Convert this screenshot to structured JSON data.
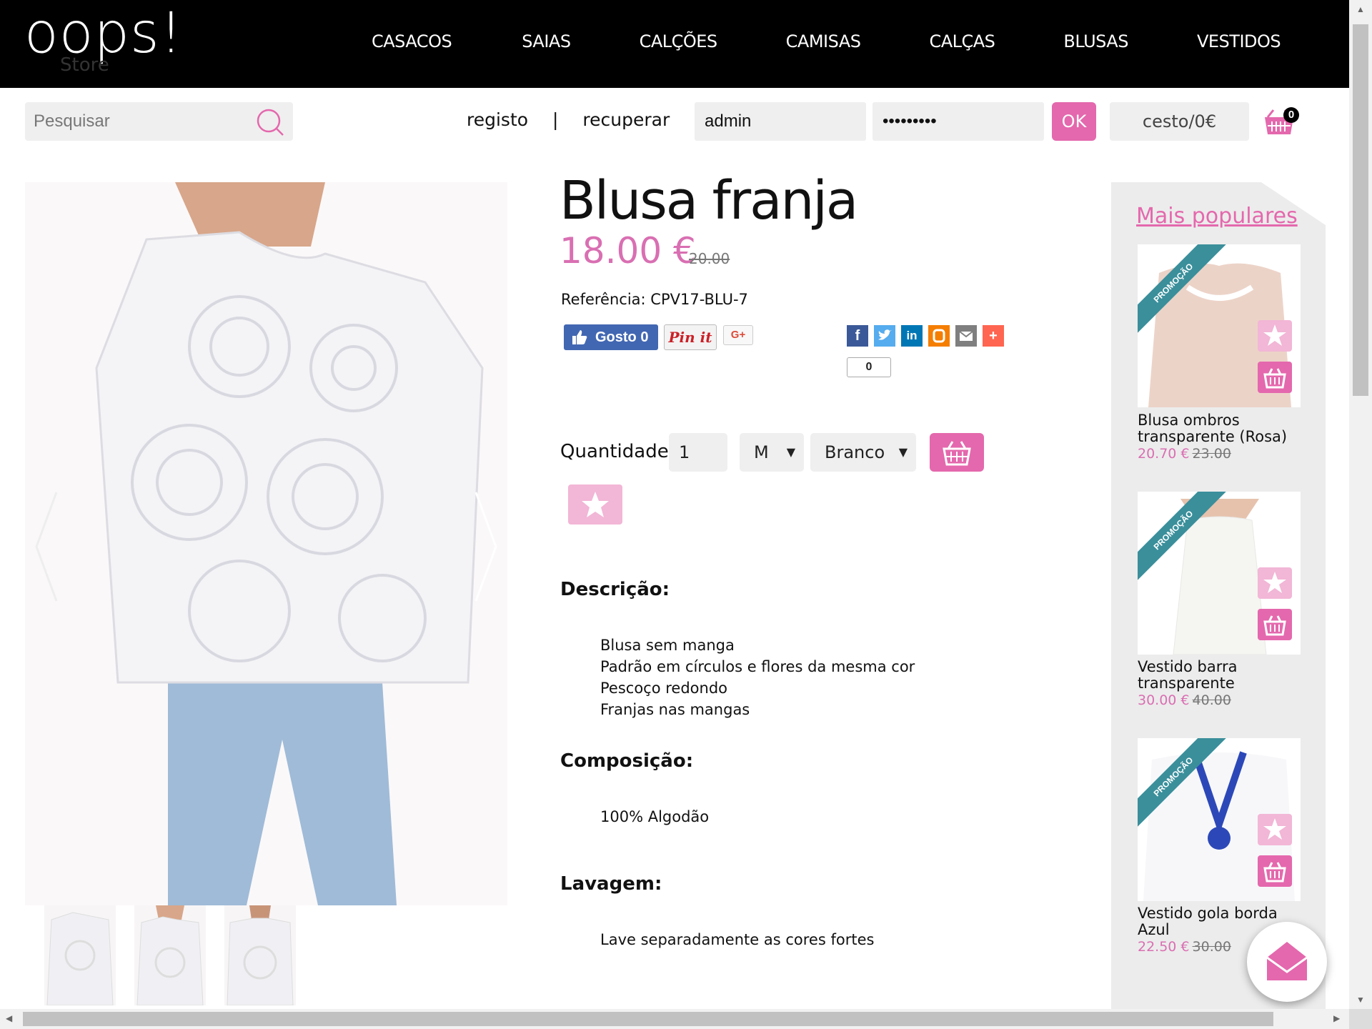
{
  "header": {
    "logo_text": "oops!",
    "logo_sub": "Store",
    "nav": [
      "CASACOS",
      "SAIAS",
      "CALÇÕES",
      "CAMISAS",
      "CALÇAS",
      "BLUSAS",
      "VESTIDOS"
    ]
  },
  "toolbar": {
    "search_placeholder": "Pesquisar",
    "register": "registo",
    "separator": "|",
    "recover": "recuperar",
    "username_value": "admin",
    "password_value": "•••••••••",
    "ok_label": "OK",
    "cart_label": "cesto/0€",
    "cart_count": "0"
  },
  "product": {
    "title": "Blusa franja",
    "price": "18.00 €",
    "old_price": "20.00",
    "reference": "Referência: CPV17-BLU-7",
    "like_label": "Gosto 0",
    "pin_label": "Pin it",
    "gplus_label": "G+",
    "share_count": "0",
    "quantity_label": "Quantidade:",
    "quantity_value": "1",
    "size_value": "M",
    "color_value": "Branco",
    "description_heading": "Descrição:",
    "description_lines": [
      "Blusa sem manga",
      "Padrão em círculos e flores da mesma cor",
      "Pescoço redondo",
      "Franjas nas mangas"
    ],
    "composition_heading": "Composição:",
    "composition_text": "100% Algodão",
    "washing_heading": "Lavagem:",
    "washing_text": "Lave separadamente as cores fortes"
  },
  "sidebar": {
    "title": "Mais populares",
    "promo_label": "PROMOÇÃO",
    "items": [
      {
        "name_line1": "Blusa ombros",
        "name_line2": "transparente (Rosa)",
        "price": "20.70 €",
        "old_price": "23.00"
      },
      {
        "name_line1": "Vestido barra",
        "name_line2": "transparente",
        "price": "30.00 €",
        "old_price": "40.00"
      },
      {
        "name_line1": "Vestido gola borda",
        "name_line2": "Azul",
        "price": "22.50 €",
        "old_price": "30.00"
      }
    ]
  },
  "colors": {
    "accent": "#e468ad",
    "price": "#d96fb2",
    "header_bg": "#000000",
    "promo": "#3a8f9b"
  }
}
